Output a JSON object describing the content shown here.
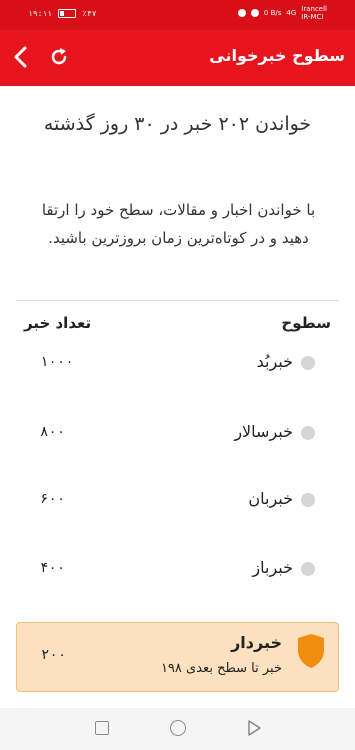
{
  "status_bar": {
    "time": "۱۹:۱۱",
    "battery": "٪۴۷",
    "carrier_1": "Irancell",
    "carrier_2": "IR-MCI",
    "network_1": "4G",
    "speed": "0 B/s"
  },
  "app_bar": {
    "title": "سطوح خبرخوانی"
  },
  "headline": "خواندن ۲۰۲ خبر در ۳۰ روز گذشته",
  "description": "با خواندن اخبار و مقالات، سطح خود را ارتقا دهید و در کوتاه‌ترین زمان بروزترین باشید.",
  "table": {
    "header_levels": "سطوح",
    "header_count": "تعداد خبر",
    "rows": [
      {
        "name": "خبربُد",
        "count": "۱۰۰۰"
      },
      {
        "name": "خبرسالار",
        "count": "۸۰۰"
      },
      {
        "name": "خبربان",
        "count": "۶۰۰"
      },
      {
        "name": "خبرباز",
        "count": "۴۰۰"
      }
    ]
  },
  "current_level": {
    "name": "خبردار",
    "count": "۲۰۰",
    "subtitle": "۱۹۸ خبر تا سطح بعدی",
    "accent": "#f08c10"
  },
  "colors": {
    "brand": "#e8141d",
    "current_bg": "#fbe1bf"
  }
}
